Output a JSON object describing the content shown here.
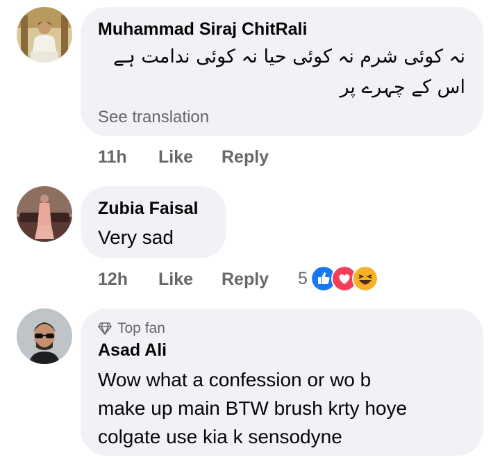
{
  "comments": [
    {
      "author": "Muhammad Siraj ChitRali",
      "text_lines": [
        "نہ کوئی شرم نہ کوئی حیا نہ کوئی ندامت ہے",
        "اس کے چہرے پر"
      ],
      "see_translation": "See translation",
      "time": "11h",
      "like_label": "Like",
      "reply_label": "Reply",
      "avatar_icon": "profile-photo-man-seated"
    },
    {
      "author": "Zubia Faisal",
      "text": "Very sad",
      "time": "12h",
      "like_label": "Like",
      "reply_label": "Reply",
      "avatar_icon": "profile-photo-woman-standing",
      "reactions": {
        "count": "5",
        "icons": [
          "like-reaction-icon",
          "love-reaction-icon",
          "haha-reaction-icon"
        ]
      }
    },
    {
      "badge_icon": "diamond-icon",
      "badge_label": "Top fan",
      "author": "Asad Ali",
      "text_lines": [
        "Wow what a confession or wo b",
        "make up main BTW brush krty hoye",
        "colgate use kia k sensodyne"
      ],
      "avatar_icon": "profile-photo-man-sunglasses"
    }
  ],
  "colors": {
    "bubble_bg": "#f0f2f5",
    "meta_text": "#65676b",
    "primary_text": "#050505",
    "like_blue": "#1877f2",
    "love_red": "#f33e58",
    "haha_yellow": "#f7b125"
  }
}
